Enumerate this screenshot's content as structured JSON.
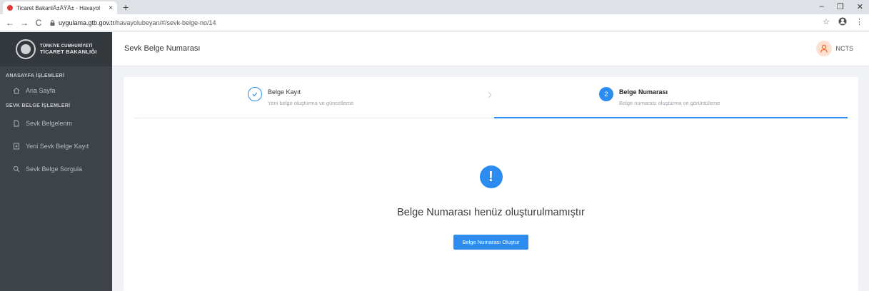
{
  "browser": {
    "tab_title": "Ticaret BakanlÄ±ÄŸÄ± - Havayol",
    "tab_close": "×",
    "new_tab": "+",
    "url_domain": "uygulama.gtb.gov.tr",
    "url_path": "/havayolubeyan/#/sevk-belge-no/14",
    "win_min": "–",
    "win_max": "❐",
    "win_close": "✕",
    "nav_back": "←",
    "nav_forward": "→",
    "nav_reload": "C",
    "star": "☆",
    "menu": "⋮"
  },
  "sidebar": {
    "logo_line1": "TÜRKİYE CUMHURİYETİ",
    "logo_line2": "TİCARET BAKANLIĞI",
    "section1": "ANASAYFA İŞLEMLERİ",
    "home": "Ana Sayfa",
    "section2": "SEVK BELGE İŞLEMLERİ",
    "items": [
      {
        "label": "Sevk Belgelerim",
        "icon": "document-icon"
      },
      {
        "label": "Yeni Sevk Belge Kayıt",
        "icon": "document-add-icon"
      },
      {
        "label": "Sevk Belge Sorgula",
        "icon": "search-icon"
      }
    ]
  },
  "header": {
    "title": "Sevk Belge Numarası",
    "user": "NCTS"
  },
  "steps": [
    {
      "title": "Belge Kayıt",
      "subtitle": "Yeni belge oluşturma ve güncelleme",
      "state": "done"
    },
    {
      "number": "2",
      "title": "Belge Numarası",
      "subtitle": "Belge numarası oluşturma ve görüntüleme",
      "state": "active"
    }
  ],
  "main": {
    "alert_symbol": "!",
    "message": "Belge Numarası henüz oluşturulmamıştır",
    "button": "Belge Numarası Oluştur"
  },
  "colors": {
    "primary": "#2d8cf0",
    "sidebar": "#3d4348"
  }
}
